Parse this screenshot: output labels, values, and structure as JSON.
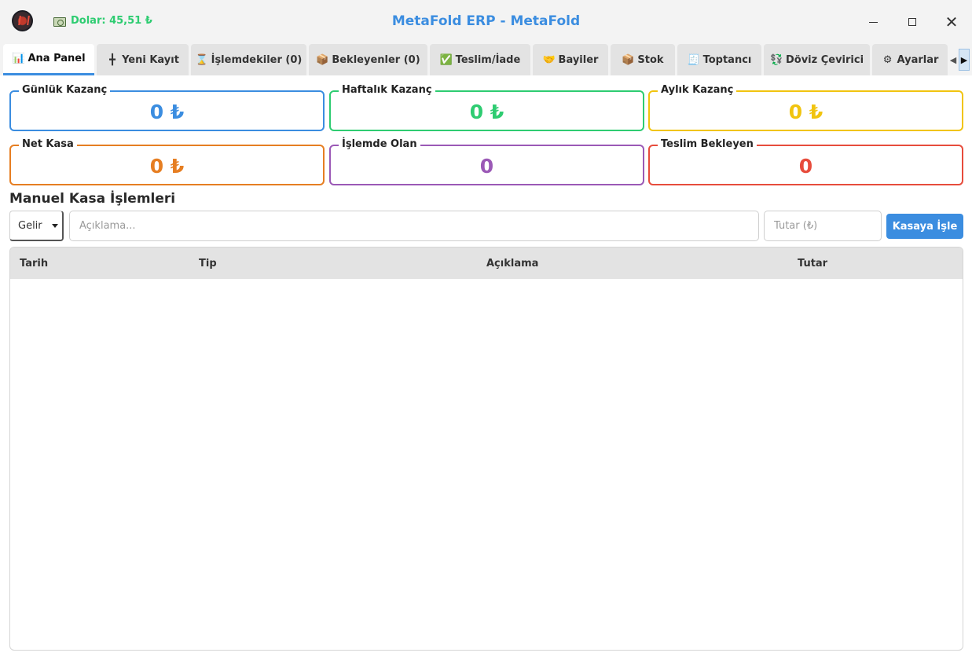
{
  "titlebar": {
    "logo_icon": "metafold-logo-icon",
    "dollar_icon": "banknote-icon",
    "dollar_text": "Dolar: 45,51 ₺",
    "title": "MetaFold ERP - MetaFold",
    "close_glyph": "✕"
  },
  "tabs": [
    {
      "icon": "📊",
      "label": "Ana Panel",
      "active": true
    },
    {
      "icon": "╋",
      "label": "Yeni Kayıt"
    },
    {
      "icon": "⌛",
      "label": "İşlemdekiler (0)"
    },
    {
      "icon": "📦",
      "label": "Bekleyenler (0)"
    },
    {
      "icon": "✅",
      "label": "Teslim/İade"
    },
    {
      "icon": "🤝",
      "label": "Bayiler"
    },
    {
      "icon": "📦",
      "label": "Stok"
    },
    {
      "icon": "🧾",
      "label": "Toptancı"
    },
    {
      "icon": "💱",
      "label": "Döviz Çevirici"
    },
    {
      "icon": "⚙",
      "label": "Ayarlar"
    }
  ],
  "tab_scroll": {
    "left": "◀",
    "right": "▶"
  },
  "cards": {
    "daily": {
      "label": "Günlük Kazanç",
      "value": "0 ₺",
      "color": "#3b8de0"
    },
    "weekly": {
      "label": "Haftalık Kazanç",
      "value": "0 ₺",
      "color": "#2ecc71"
    },
    "monthly": {
      "label": "Aylık Kazanç",
      "value": "0 ₺",
      "color": "#f1c40f"
    },
    "net": {
      "label": "Net Kasa",
      "value": "0 ₺",
      "color": "#e67e22"
    },
    "in_process": {
      "label": "İşlemde Olan",
      "value": "0",
      "color": "#9b59b6"
    },
    "awaiting": {
      "label": "Teslim Bekleyen",
      "value": "0",
      "color": "#e74c3c"
    }
  },
  "manual": {
    "title": "Manuel Kasa İşlemleri",
    "type_selected": "Gelir",
    "description_placeholder": "Açıklama...",
    "amount_placeholder": "Tutar (₺)",
    "submit_label": "Kasaya İşle"
  },
  "table": {
    "columns": [
      "Tarih",
      "Tip",
      "Açıklama",
      "Tutar"
    ],
    "rows": []
  }
}
